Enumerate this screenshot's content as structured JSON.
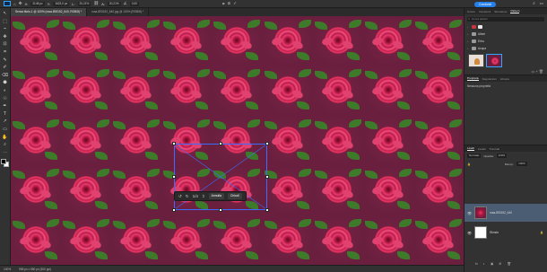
{
  "options_bar": {
    "x_label": "X:",
    "x_value": "3148 px",
    "y_label": "Y:",
    "y_value": "1623,0 px",
    "w_label": "L:",
    "w_value": "20,21%",
    "h_label": "A:",
    "h_value": "20,21%",
    "angle_value": "0,00",
    "share_label": "Condividi"
  },
  "tabs": [
    {
      "label": "Senza titolo-1 @ 100% (rosa-893152_640, RGB/8) *"
    },
    {
      "label": "rosa-893152_640.jpg @ 100% (RGB/8) *"
    }
  ],
  "tools": [
    "↖",
    "⬚",
    "⌁",
    "✥",
    "⊡",
    "⌗",
    "✎",
    "✐",
    "⌫",
    "⬣",
    "◐",
    "☉",
    "✒",
    "T",
    "↗",
    "▭",
    "✋",
    "⌕",
    "⋯"
  ],
  "canvas": {
    "tile_count_x": 9,
    "tile_count_y": 5,
    "background": "#6a1f3e"
  },
  "transform_controls": {
    "undo_icon": "↺",
    "redo_icon": "↻",
    "size_label": "1/4",
    "flip_icon": "⇳",
    "cancel_label": "Annulla",
    "close_label": "Chiudi"
  },
  "status": {
    "zoom": "100%",
    "doc_size": "955 px x 950 px (300 ppi)"
  },
  "panels": {
    "top_tabs": [
      "Colore",
      "Campioni",
      "Sfumature",
      "Pattern"
    ],
    "active_top_tab": "Pattern",
    "search_placeholder": "Cerca pattern",
    "folders": [
      {
        "name": "Alberi"
      },
      {
        "name": "Erba"
      },
      {
        "name": "Acqua"
      }
    ],
    "mid_tabs": [
      "Proprietà",
      "Regolazioni",
      "Librerie"
    ],
    "active_mid_tab": "Proprietà",
    "properties_text": "Nessuna proprietà",
    "layer_tabs": [
      "Livelli",
      "Canali",
      "Tracciati"
    ],
    "active_layer_tab": "Livelli",
    "blend_mode": "Normale",
    "opacity_label": "Opacità:",
    "opacity": "100%",
    "fill_label": "Riemp.:",
    "fill": "100%",
    "layers": [
      {
        "name": "rosa-893152_640",
        "active": true
      },
      {
        "name": "Sfondo",
        "active": false
      }
    ],
    "bottom_icons": [
      "fx",
      "◐",
      "▣",
      "⊞",
      "🗑"
    ]
  }
}
